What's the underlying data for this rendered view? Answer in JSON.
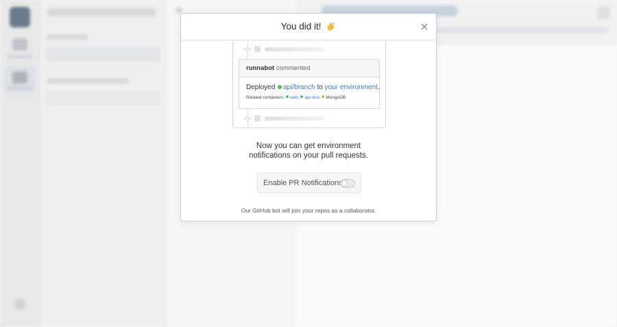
{
  "modal": {
    "title": "You did it!",
    "title_emoji_icon": "clapping-hands-icon",
    "close_icon": "close-icon",
    "message_line1": "Now you can get environment",
    "message_line2": "notifications on your pull requests.",
    "enable_button_label": "Enable PR Notifications",
    "toggle_state": "off",
    "footer_note": "Our GitHub bot will join your repos as a collaborator."
  },
  "illustration": {
    "comment_author": "runnabot",
    "comment_action": "commented",
    "deployed_word": "Deployed",
    "branch": "api/branch",
    "to_word": "to",
    "environment_link": "your environment",
    "period": ".",
    "related_label": "Related containers:",
    "containers": [
      {
        "name": "web",
        "status_color": "#5cb85c",
        "sep": ","
      },
      {
        "name": "api-test",
        "status_color": "#5cb85c",
        "sep": ","
      },
      {
        "name": "MongoDB",
        "status_color": "#e0b030",
        "sep": ""
      }
    ]
  },
  "colors": {
    "link_blue": "#3f7bbf",
    "status_green": "#5cb85c",
    "status_yellow": "#e0b030"
  }
}
